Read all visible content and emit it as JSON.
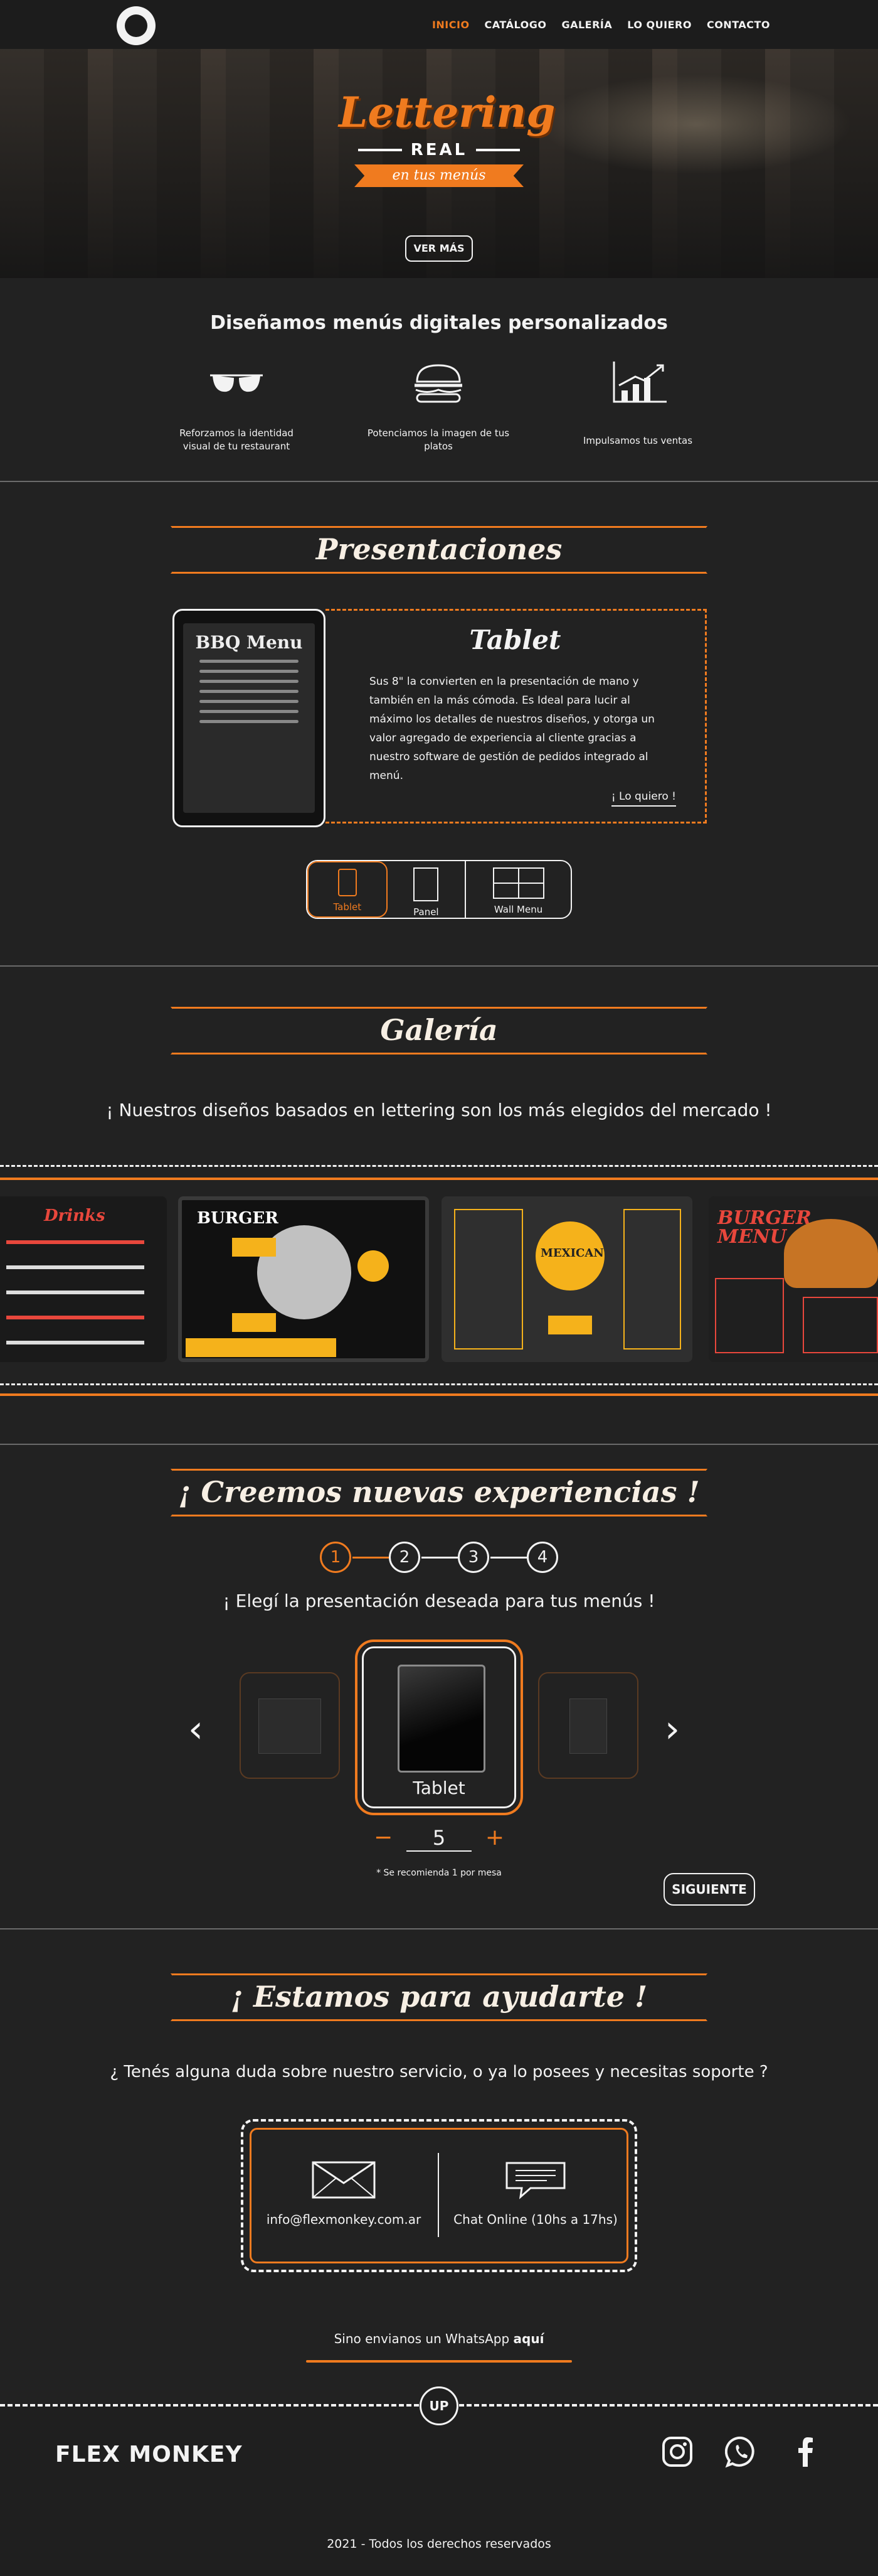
{
  "nav": {
    "items": [
      {
        "label": "INICIO",
        "active": true
      },
      {
        "label": "CATÁLOGO"
      },
      {
        "label": "GALERÍA"
      },
      {
        "label": "LO QUIERO"
      },
      {
        "label": "CONTACTO"
      }
    ]
  },
  "hero": {
    "title_script": "Lettering",
    "title_bold": "REAL",
    "banner": "en tus menús",
    "cta": "VER MÁS"
  },
  "services": {
    "title": "Diseñamos menús digitales personalizados",
    "items": [
      {
        "icon": "glasses-icon",
        "text": "Reforzamos la identidad visual de tu restaurant"
      },
      {
        "icon": "burger-icon",
        "text": "Potenciamos la imagen de tus platos"
      },
      {
        "icon": "growth-chart-icon",
        "text": "Impulsamos tus ventas"
      }
    ]
  },
  "presentaciones": {
    "title": "Presentaciones",
    "card_title": "Tablet",
    "card_text": "Sus 8\" la convierten en la presentación de mano y también en la más cómoda.  Es Ideal para lucir al máximo los detalles de nuestros diseños, y otorga un valor agregado de experiencia al cliente gracias a nuestro  software de gestión de pedidos integrado al menú.",
    "card_cta": "¡ Lo quiero !",
    "tablet_menu_title": "BBQ Menu",
    "tabs": [
      {
        "label": "Tablet",
        "active": true
      },
      {
        "label": "Panel"
      },
      {
        "label": "Wall Menu"
      }
    ]
  },
  "galeria": {
    "title": "Galería",
    "subtitle": "¡ Nuestros diseños basados en lettering son los más elegidos del mercado !",
    "images": [
      {
        "caption": "Drinks"
      },
      {
        "caption": "BURGER"
      },
      {
        "caption": "MEXICAN"
      },
      {
        "caption": "BURGER MENU"
      }
    ]
  },
  "experiencias": {
    "title": "¡ Creemos nuevas experiencias !",
    "steps": [
      "1",
      "2",
      "3",
      "4"
    ],
    "active_step": 1,
    "subtitle": "¡ Elegí la presentación deseada para tus menús !",
    "selected": "Tablet",
    "quantity": "5",
    "minus": "−",
    "plus": "+",
    "note": "* Se recomienda 1 por mesa",
    "next": "SIGUIENTE"
  },
  "ayuda": {
    "title": "¡ Estamos para ayudarte !",
    "subtitle": "¿ Tenés alguna duda sobre nuestro servicio, o ya lo posees y necesitas soporte ?",
    "email": "info@flexmonkey.com.ar",
    "chat": "Chat Online (10hs a 17hs)",
    "whatsapp_prefix": "Sino envianos un WhatsApp ",
    "whatsapp_link": "aquí"
  },
  "footer": {
    "up": "UP",
    "brand": "FLEX MONKEY",
    "social": [
      "instagram-icon",
      "whatsapp-icon",
      "facebook-icon"
    ],
    "copyright": "2021 - Todos los derechos reservados"
  },
  "colors": {
    "accent": "#f07b1f",
    "background": "#222222",
    "text": "#f3f3f3"
  }
}
